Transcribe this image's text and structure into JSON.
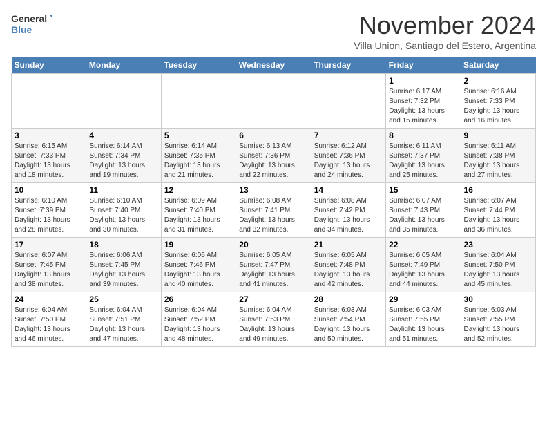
{
  "logo": {
    "line1": "General",
    "line2": "Blue"
  },
  "title": "November 2024",
  "subtitle": "Villa Union, Santiago del Estero, Argentina",
  "days_header": [
    "Sunday",
    "Monday",
    "Tuesday",
    "Wednesday",
    "Thursday",
    "Friday",
    "Saturday"
  ],
  "weeks": [
    [
      {
        "day": "",
        "info": ""
      },
      {
        "day": "",
        "info": ""
      },
      {
        "day": "",
        "info": ""
      },
      {
        "day": "",
        "info": ""
      },
      {
        "day": "",
        "info": ""
      },
      {
        "day": "1",
        "info": "Sunrise: 6:17 AM\nSunset: 7:32 PM\nDaylight: 13 hours and 15 minutes."
      },
      {
        "day": "2",
        "info": "Sunrise: 6:16 AM\nSunset: 7:33 PM\nDaylight: 13 hours and 16 minutes."
      }
    ],
    [
      {
        "day": "3",
        "info": "Sunrise: 6:15 AM\nSunset: 7:33 PM\nDaylight: 13 hours and 18 minutes."
      },
      {
        "day": "4",
        "info": "Sunrise: 6:14 AM\nSunset: 7:34 PM\nDaylight: 13 hours and 19 minutes."
      },
      {
        "day": "5",
        "info": "Sunrise: 6:14 AM\nSunset: 7:35 PM\nDaylight: 13 hours and 21 minutes."
      },
      {
        "day": "6",
        "info": "Sunrise: 6:13 AM\nSunset: 7:36 PM\nDaylight: 13 hours and 22 minutes."
      },
      {
        "day": "7",
        "info": "Sunrise: 6:12 AM\nSunset: 7:36 PM\nDaylight: 13 hours and 24 minutes."
      },
      {
        "day": "8",
        "info": "Sunrise: 6:11 AM\nSunset: 7:37 PM\nDaylight: 13 hours and 25 minutes."
      },
      {
        "day": "9",
        "info": "Sunrise: 6:11 AM\nSunset: 7:38 PM\nDaylight: 13 hours and 27 minutes."
      }
    ],
    [
      {
        "day": "10",
        "info": "Sunrise: 6:10 AM\nSunset: 7:39 PM\nDaylight: 13 hours and 28 minutes."
      },
      {
        "day": "11",
        "info": "Sunrise: 6:10 AM\nSunset: 7:40 PM\nDaylight: 13 hours and 30 minutes."
      },
      {
        "day": "12",
        "info": "Sunrise: 6:09 AM\nSunset: 7:40 PM\nDaylight: 13 hours and 31 minutes."
      },
      {
        "day": "13",
        "info": "Sunrise: 6:08 AM\nSunset: 7:41 PM\nDaylight: 13 hours and 32 minutes."
      },
      {
        "day": "14",
        "info": "Sunrise: 6:08 AM\nSunset: 7:42 PM\nDaylight: 13 hours and 34 minutes."
      },
      {
        "day": "15",
        "info": "Sunrise: 6:07 AM\nSunset: 7:43 PM\nDaylight: 13 hours and 35 minutes."
      },
      {
        "day": "16",
        "info": "Sunrise: 6:07 AM\nSunset: 7:44 PM\nDaylight: 13 hours and 36 minutes."
      }
    ],
    [
      {
        "day": "17",
        "info": "Sunrise: 6:07 AM\nSunset: 7:45 PM\nDaylight: 13 hours and 38 minutes."
      },
      {
        "day": "18",
        "info": "Sunrise: 6:06 AM\nSunset: 7:45 PM\nDaylight: 13 hours and 39 minutes."
      },
      {
        "day": "19",
        "info": "Sunrise: 6:06 AM\nSunset: 7:46 PM\nDaylight: 13 hours and 40 minutes."
      },
      {
        "day": "20",
        "info": "Sunrise: 6:05 AM\nSunset: 7:47 PM\nDaylight: 13 hours and 41 minutes."
      },
      {
        "day": "21",
        "info": "Sunrise: 6:05 AM\nSunset: 7:48 PM\nDaylight: 13 hours and 42 minutes."
      },
      {
        "day": "22",
        "info": "Sunrise: 6:05 AM\nSunset: 7:49 PM\nDaylight: 13 hours and 44 minutes."
      },
      {
        "day": "23",
        "info": "Sunrise: 6:04 AM\nSunset: 7:50 PM\nDaylight: 13 hours and 45 minutes."
      }
    ],
    [
      {
        "day": "24",
        "info": "Sunrise: 6:04 AM\nSunset: 7:50 PM\nDaylight: 13 hours and 46 minutes."
      },
      {
        "day": "25",
        "info": "Sunrise: 6:04 AM\nSunset: 7:51 PM\nDaylight: 13 hours and 47 minutes."
      },
      {
        "day": "26",
        "info": "Sunrise: 6:04 AM\nSunset: 7:52 PM\nDaylight: 13 hours and 48 minutes."
      },
      {
        "day": "27",
        "info": "Sunrise: 6:04 AM\nSunset: 7:53 PM\nDaylight: 13 hours and 49 minutes."
      },
      {
        "day": "28",
        "info": "Sunrise: 6:03 AM\nSunset: 7:54 PM\nDaylight: 13 hours and 50 minutes."
      },
      {
        "day": "29",
        "info": "Sunrise: 6:03 AM\nSunset: 7:55 PM\nDaylight: 13 hours and 51 minutes."
      },
      {
        "day": "30",
        "info": "Sunrise: 6:03 AM\nSunset: 7:55 PM\nDaylight: 13 hours and 52 minutes."
      }
    ]
  ]
}
